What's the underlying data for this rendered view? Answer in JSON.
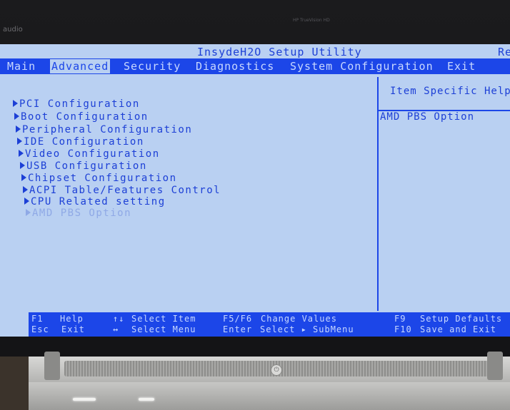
{
  "bezel": {
    "brand": "audio",
    "camera_label": "HP TrueVision HD"
  },
  "bios": {
    "title": "InsydeH2O Setup Utility",
    "title_extra": "Re",
    "menu": [
      {
        "label": "Main"
      },
      {
        "label": "Advanced",
        "active": true
      },
      {
        "label": "Security"
      },
      {
        "label": "Diagnostics"
      },
      {
        "label": "System Configuration"
      },
      {
        "label": "Exit"
      }
    ],
    "entries": [
      {
        "label": "PCI Configuration"
      },
      {
        "label": "Boot Configuration"
      },
      {
        "label": "Peripheral Configuration"
      },
      {
        "label": "IDE Configuration"
      },
      {
        "label": "Video Configuration"
      },
      {
        "label": "USB Configuration"
      },
      {
        "label": "Chipset Configuration"
      },
      {
        "label": "ACPI Table/Features Control"
      },
      {
        "label": "CPU Related setting"
      },
      {
        "label": "AMD PBS Option",
        "selected": true
      }
    ],
    "help": {
      "title": "Item Specific Help",
      "text": "AMD PBS Option"
    },
    "footer": {
      "f1_key": "F1",
      "f1_label": "Help",
      "esc_key": "Esc",
      "esc_label": "Exit",
      "updown_key": "↑↓",
      "updown_label": "Select Item",
      "leftright_key": "↔",
      "leftright_label": "Select Menu",
      "f5f6_key": "F5/F6",
      "f5f6_label": "Change Values",
      "enter_key": "Enter",
      "enter_label": "Select ▸ SubMenu",
      "f9_key": "F9",
      "f9_label": "Setup Defaults",
      "f10_key": "F10",
      "f10_label": "Save and Exit"
    },
    "colors": {
      "background": "#b9d0f2",
      "accent": "#1c46e8",
      "text": "#1c3fd6",
      "disabled_text": "#8fa9e6"
    }
  }
}
